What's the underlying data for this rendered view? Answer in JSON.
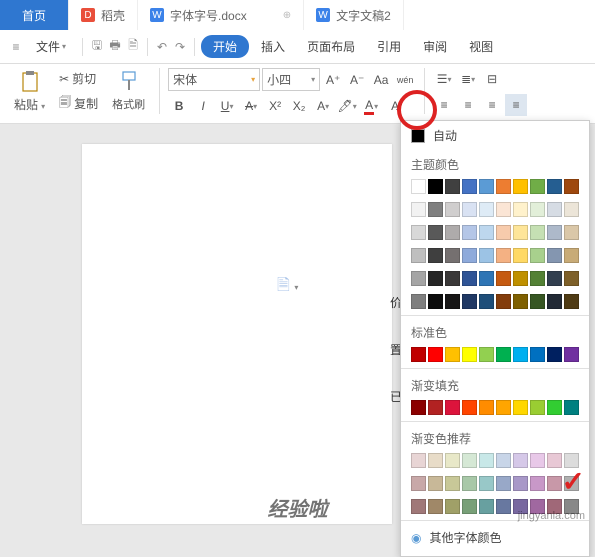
{
  "tabs": {
    "home": "首页",
    "t1": "稻壳",
    "t2": "字体字号.docx",
    "t3": "文字文稿2"
  },
  "menubar": {
    "file": "文件",
    "start": "开始",
    "insert": "插入",
    "layout": "页面布局",
    "ref": "引用",
    "review": "审阅",
    "view": "视图"
  },
  "toolbar": {
    "cut": "剪切",
    "copy": "复制",
    "paste": "粘贴",
    "format_painter": "格式刷",
    "font_name": "宋体",
    "font_size": "小四"
  },
  "dropdown": {
    "auto": "自动",
    "theme": "主题颜色",
    "standard": "标准色",
    "gradient": "渐变填充",
    "gradient_rec": "渐变色推荐",
    "more": "其他字体颜色"
  },
  "theme_row1": [
    "#ffffff",
    "#000000",
    "#404040",
    "#4472c4",
    "#5b9bd5",
    "#ed7d31",
    "#ffc000",
    "#70ad47",
    "#255e91",
    "#9e480e"
  ],
  "theme_grid": [
    [
      "#f2f2f2",
      "#7f7f7f",
      "#d0cece",
      "#d9e2f3",
      "#deebf6",
      "#fbe5d5",
      "#fff2cc",
      "#e2efd9",
      "#d6dce4",
      "#ece5d8"
    ],
    [
      "#d8d8d8",
      "#595959",
      "#aeabab",
      "#b4c6e7",
      "#bdd7ee",
      "#f7cbac",
      "#fee599",
      "#c5e0b3",
      "#adb9ca",
      "#dac7a8"
    ],
    [
      "#bfbfbf",
      "#3f3f3f",
      "#757070",
      "#8eaadb",
      "#9cc3e5",
      "#f4b183",
      "#ffd965",
      "#a8d08d",
      "#8496b0",
      "#c8ab77"
    ],
    [
      "#a5a5a5",
      "#262626",
      "#3a3838",
      "#2f5496",
      "#2e75b5",
      "#c55a11",
      "#bf9000",
      "#538135",
      "#323f4f",
      "#7e6029"
    ],
    [
      "#7f7f7f",
      "#0c0c0c",
      "#171616",
      "#1f3864",
      "#1e4e79",
      "#833c0b",
      "#7f6000",
      "#375623",
      "#222a35",
      "#4f3b14"
    ]
  ],
  "standard_colors": [
    "#c00000",
    "#ff0000",
    "#ffc000",
    "#ffff00",
    "#92d050",
    "#00b050",
    "#00b0f0",
    "#0070c0",
    "#002060",
    "#7030a0"
  ],
  "gradient_colors": [
    "#8b0000",
    "#b22222",
    "#dc143c",
    "#ff4500",
    "#ff8c00",
    "#ffa500",
    "#ffd700",
    "#9acd32",
    "#32cd32",
    "#008080"
  ],
  "gradient_rec": [
    [
      "#e8d5d5",
      "#e8dcc8",
      "#e8e8c8",
      "#d5e8d5",
      "#c8e8e8",
      "#c8d5e8",
      "#d5c8e8",
      "#e8c8e8",
      "#e8c8d5",
      "#dcdcdc"
    ],
    [
      "#c8a8a8",
      "#c8b898",
      "#c8c898",
      "#a8c8a8",
      "#98c8c8",
      "#98a8c8",
      "#a898c8",
      "#c898c8",
      "#c898a8",
      "#b0b0b0"
    ],
    [
      "#a07878",
      "#a08868",
      "#a0a068",
      "#78a078",
      "#68a0a0",
      "#6878a0",
      "#7868a0",
      "#a068a0",
      "#a06878",
      "#888888"
    ]
  ],
  "page_text": {
    "a": "价",
    "b": "置",
    "c": "已"
  },
  "watermark": "经验啦",
  "watermark_url": "jingyanla.com"
}
